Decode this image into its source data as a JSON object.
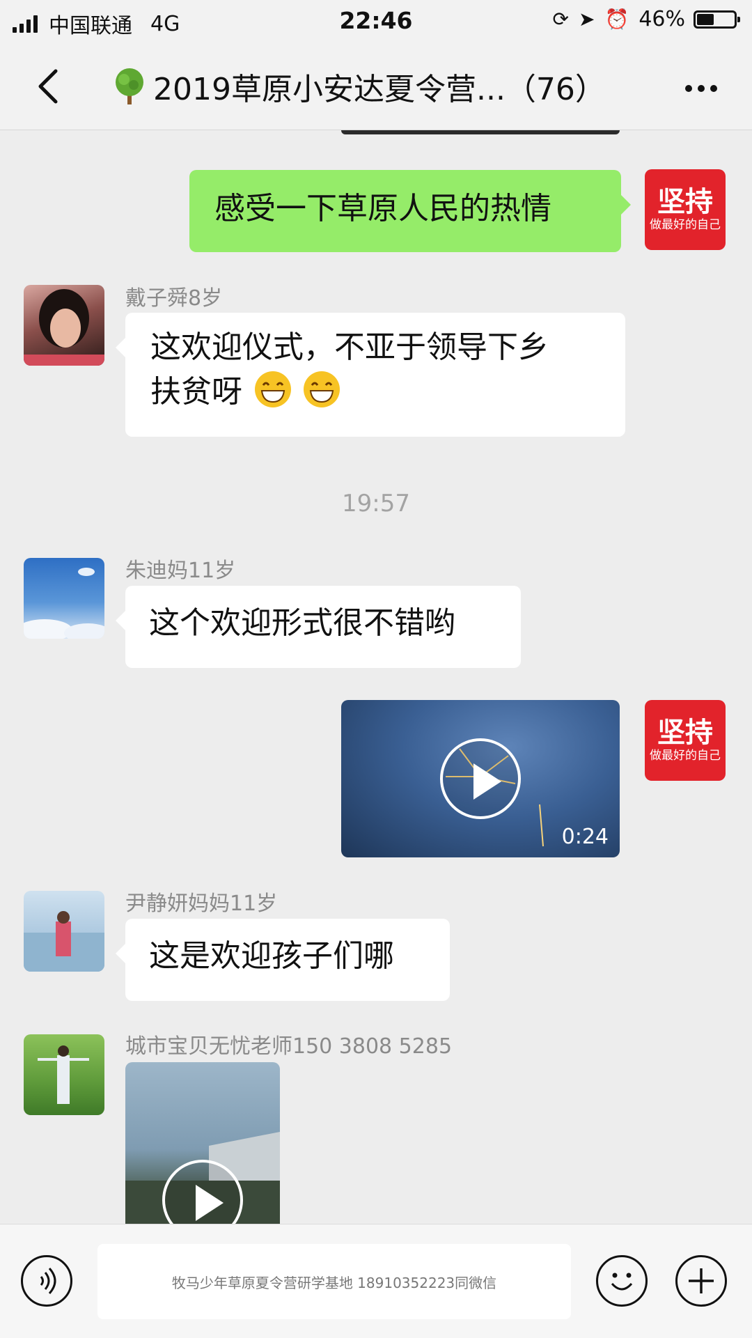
{
  "status_bar": {
    "carrier": "中国联通",
    "network": "4G",
    "time": "22:46",
    "battery": "46%",
    "battery_level": 0.46
  },
  "nav": {
    "title": "2019草原小安达夏令营...（76）"
  },
  "messages": [
    {
      "sender": "self",
      "text": "感受一下草原人民的热情",
      "avatar_text": "坚持",
      "avatar_sub": "做最好的自己"
    },
    {
      "sender": "戴子舜8岁",
      "text_line1": "这欢迎仪式，不亚于领导下乡",
      "text_line2": "扶贫呀"
    },
    {
      "timestamp": "19:57"
    },
    {
      "sender": "朱迪妈11岁",
      "text": "这个欢迎形式很不错哟"
    },
    {
      "sender": "self",
      "type": "video",
      "duration": "0:24"
    },
    {
      "sender": "尹静妍妈妈11岁",
      "text": "这是欢迎孩子们哪"
    },
    {
      "sender": "城市宝贝无忧老师150 3808 5285",
      "type": "video"
    }
  ],
  "input": {
    "watermark": "牧马少年草原夏令营研学基地 18910352223同微信"
  },
  "colors": {
    "self_bubble": "#95ec69",
    "other_bubble": "#ffffff",
    "background": "#ededed",
    "self_avatar": "#e2232b"
  }
}
